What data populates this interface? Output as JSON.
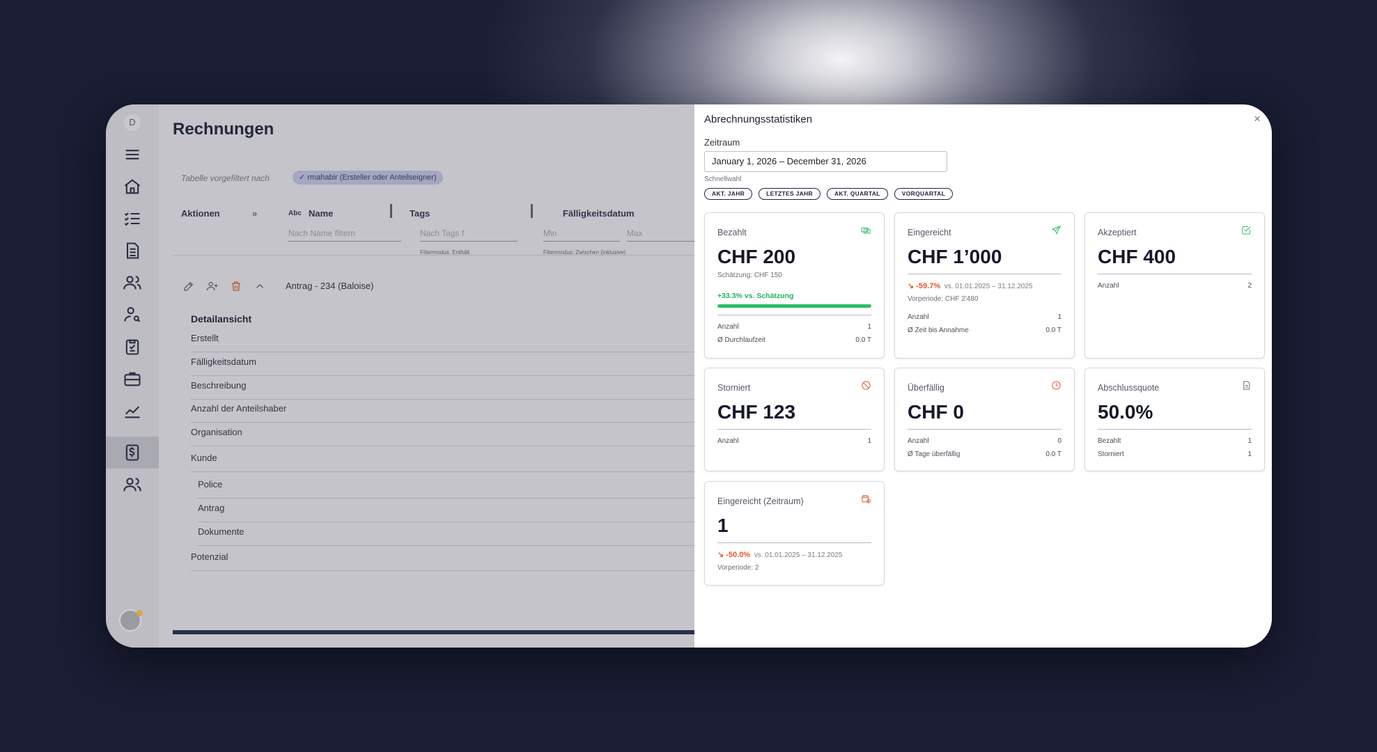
{
  "app": {
    "rail_initial": "D",
    "page_title": "Rechnungen",
    "prefilter_label": "Tabelle vorgefiltert nach",
    "prefilter_chip": "rmahabir (Ersteller oder Anteilseigner)",
    "columns": {
      "actions": "Aktionen",
      "name_type": "Abc",
      "name": "Name",
      "name_placeholder": "Nach Name filtern",
      "tags": "Tags",
      "tags_placeholder": "Nach Tags f",
      "tags_mode": "Filtermodus: Enthält",
      "due": "Fälligkeitsdatum",
      "due_min": "Min",
      "due_max": "Max",
      "due_mode": "Filtermodus: Zwischen (inklusive)"
    },
    "row_title": "Antrag - 234 (Baloise)",
    "detail": {
      "heading": "Detailansicht",
      "fields": [
        "Erstellt",
        "Fälligkeitsdatum",
        "Beschreibung",
        "Anzahl der Anteilshaber",
        "Organisation",
        "Kunde"
      ],
      "sub_fields": [
        "Police",
        "Antrag",
        "Dokumente"
      ],
      "last_field": "Potenzial"
    }
  },
  "panel": {
    "title": "Abrechnungsstatistiken",
    "close": "×",
    "zeitraum_label": "Zeitraum",
    "zeitraum_value": "January 1, 2026 – December 31, 2026",
    "schnellwahl_label": "Schnellwahl",
    "quick_chips": [
      "AKT. JAHR",
      "LETZTES JAHR",
      "AKT. QUARTAL",
      "VORQUARTAL"
    ]
  },
  "cards": {
    "bezahlt": {
      "title": "Bezahlt",
      "value": "CHF 200",
      "estimate": "Schätzung: CHF 150",
      "progress_label": "+33.3% vs. Schätzung",
      "progress_fraction": 1.0,
      "rows": [
        [
          "Anzahl",
          "1"
        ],
        [
          "Ø Durchlaufzeit",
          "0.0 T"
        ]
      ],
      "icon": "cash-icon",
      "icon_color": "#2fbd62"
    },
    "eingereicht": {
      "title": "Eingereicht",
      "value": "CHF 1’000",
      "trend": "↘ -59.7%",
      "trend_range": "vs. 01.01.2025 – 31.12.2025",
      "prev": "Vorperiode: CHF 2'480",
      "rows": [
        [
          "Anzahl",
          "1"
        ],
        [
          "Ø Zeit bis Annahme",
          "0.0 T"
        ]
      ],
      "icon": "send-icon",
      "icon_color": "#2fbd62"
    },
    "akzeptiert": {
      "title": "Akzeptiert",
      "value": "CHF 400",
      "rows": [
        [
          "Anzahl",
          "2"
        ]
      ],
      "icon": "check-square-icon",
      "icon_color": "#2fbd62"
    },
    "storniert": {
      "title": "Storniert",
      "value": "CHF 123",
      "rows": [
        [
          "Anzahl",
          "1"
        ]
      ],
      "icon": "ban-icon",
      "icon_color": "#e0582a"
    },
    "ueberfaellig": {
      "title": "Überfällig",
      "value": "CHF 0",
      "rows": [
        [
          "Anzahl",
          "0"
        ],
        [
          "Ø Tage überfällig",
          "0.0 T"
        ]
      ],
      "icon": "clock-icon",
      "icon_color": "#e0582a"
    },
    "abschluss": {
      "title": "Abschlussquote",
      "value": "50.0%",
      "rows": [
        [
          "Bezahlt",
          "1"
        ],
        [
          "Storniert",
          "1"
        ]
      ],
      "icon": "document-icon",
      "icon_color": "#6b6d78"
    },
    "eingereicht_zeitraum": {
      "title": "Eingereicht (Zeitraum)",
      "value": "1",
      "trend": "↘ -50.0%",
      "trend_range": "vs. 01.01.2025 – 31.12.2025",
      "prev": "Vorperiode: 2",
      "icon": "calendar-clock-icon",
      "icon_color": "#e0582a"
    }
  }
}
